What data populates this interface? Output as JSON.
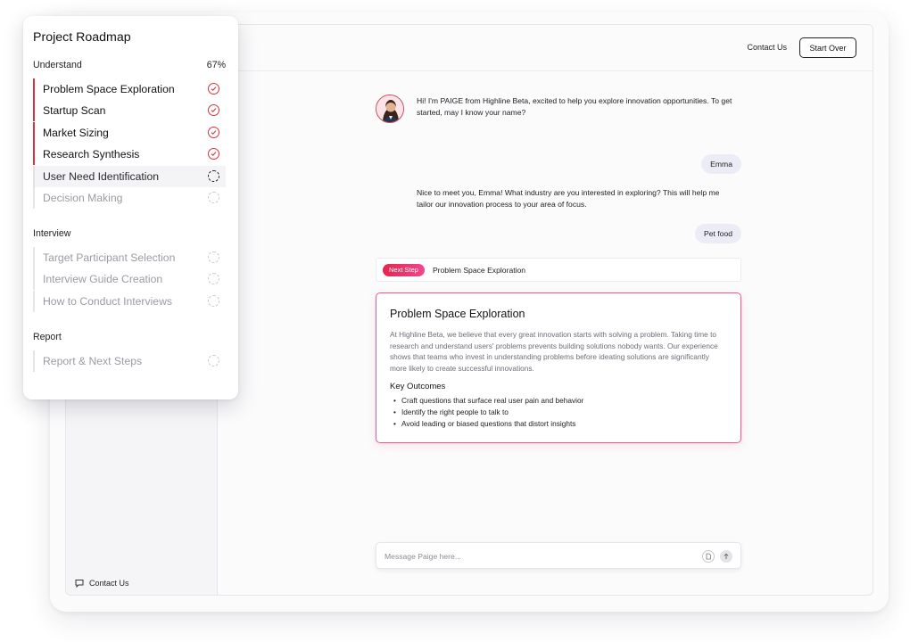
{
  "topbar": {
    "contact_label": "Contact Us",
    "start_over_label": "Start Over"
  },
  "sidebar": {
    "contact_label": "Contact Us"
  },
  "chat": {
    "messages": [
      {
        "from": "bot",
        "text": "Hi! I'm PAIGE from Highline Beta, excited to help you explore innovation opportunities. To get started, may I know your name?"
      },
      {
        "from": "user",
        "text": "Emma"
      },
      {
        "from": "bot",
        "text": "Nice to meet you, Emma! What industry are you interested in exploring? This will help me tailor our innovation process to your area of focus."
      },
      {
        "from": "user",
        "text": "Pet food"
      }
    ],
    "next_step": {
      "badge": "Next Step",
      "title": "Problem Space Exploration"
    },
    "card": {
      "title": "Problem Space Exploration",
      "description": "At Highline Beta, we believe that every great innovation starts with solving a problem. Taking time to research and understand users' problems prevents building solutions nobody wants. Our experience shows that teams who invest in understanding problems before ideating solutions are significantly more likely to create successful innovations.",
      "outcomes_heading": "Key Outcomes",
      "outcomes": [
        "Craft questions that surface real user pain and behavior",
        "Identify the right people to talk to",
        "Avoid leading or biased questions that distort insights"
      ]
    },
    "composer": {
      "placeholder": "Message Paige here..."
    }
  },
  "roadmap": {
    "title": "Project Roadmap",
    "sections": [
      {
        "label": "Understand",
        "progress": "67%",
        "steps": [
          {
            "label": "Problem Space Exploration",
            "status": "done"
          },
          {
            "label": "Startup Scan",
            "status": "done"
          },
          {
            "label": "Market Sizing",
            "status": "done"
          },
          {
            "label": "Research Synthesis",
            "status": "done"
          },
          {
            "label": "User Need Identification",
            "status": "current"
          },
          {
            "label": "Decision Making",
            "status": "todo"
          }
        ]
      },
      {
        "label": "Interview",
        "steps": [
          {
            "label": "Target Participant Selection",
            "status": "todo"
          },
          {
            "label": "Interview Guide Creation",
            "status": "todo"
          },
          {
            "label": "How to Conduct Interviews",
            "status": "todo"
          }
        ]
      },
      {
        "label": "Report",
        "steps": [
          {
            "label": "Report & Next Steps",
            "status": "todo"
          }
        ]
      }
    ]
  },
  "colors": {
    "accent": "#d9343d",
    "badge_gradient_start": "#e8244c",
    "badge_gradient_end": "#f0478c",
    "card_border": "#ee5a86"
  }
}
